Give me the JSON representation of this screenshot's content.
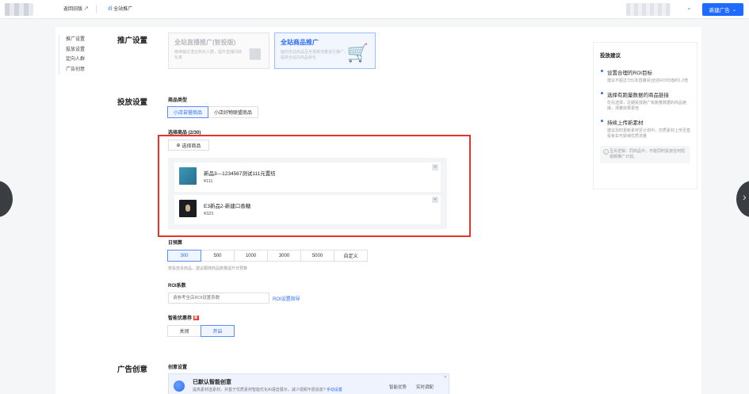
{
  "topbar": {
    "back_label": "返回旧版 ↗",
    "tab_label": "全站推广",
    "new_ad_label": "新建广告",
    "chevron": "⌄"
  },
  "sidenav": {
    "items": [
      "推广设置",
      "投放设置",
      "定向人群",
      "广告创意"
    ]
  },
  "promo": {
    "section_title": "推广设置",
    "cards": [
      {
        "title": "全站直播推广(智投版)",
        "desc": "精准触达潜在购买人群，提升直播间转化率"
      },
      {
        "title": "全站商品推广",
        "desc": "面向全站商品及全场景流量进行推广，提高全站内商品转化"
      }
    ]
  },
  "delivery": {
    "section_title": "投放设置",
    "product_type_label": "商品类型",
    "product_types": [
      "小店自营商品",
      "小店好物联盟商品"
    ],
    "selected_goods_label": "选择商品 (2/30)",
    "select_btn_label": "选择商品",
    "goods": [
      {
        "name": "新品3---1234567测试111元置纺",
        "price": "¥111"
      },
      {
        "name": "E3新品2-新建口香糖",
        "price": "¥323"
      }
    ],
    "budget_label": "日预算",
    "budgets": [
      "300",
      "500",
      "1000",
      "3000",
      "5000",
      "自定义"
    ],
    "budget_hint": "若投放多商品，建议跟随商品数量提升日预算",
    "roi_label": "ROI系数",
    "roi_placeholder": "请参考全店ROI设置系数",
    "roi_link": "ROI设置指导",
    "coupon_label": "智能优惠券",
    "coupon_new_tag": "新",
    "coupon_options": [
      "关闭",
      "开启"
    ]
  },
  "creative": {
    "section_title": "广告创意",
    "setting_label": "创意设置",
    "box_title": "已默认智能创意",
    "box_desc": "提高素材选素材，并基于优质素材智能优化AI语音展示，减少视频不愿投放?",
    "box_link": "手动设置",
    "btn_smart": "智能优势",
    "btn_realtime": "实时调配",
    "close": "✕"
  },
  "suggest": {
    "title": "投放建议",
    "items": [
      {
        "title": "设置合理的ROI目标",
        "desc": "建议不超过7日(本直播间)全店ROI均值的1.2倍"
      },
      {
        "title": "选择有跑量数据的商品链接",
        "desc": "优先选择，近期投放跑广有跑量数据的商品链接，测量效果更佳"
      },
      {
        "title": "持续上传新素材",
        "desc": "建议及时更新素材至计划中，优质素材上传至直投板车可获得优质流量"
      }
    ],
    "note": "互斥逻辑：同商品中，不能同时投放任何短视频推广计划。"
  },
  "icons": {
    "plus": "⊕",
    "close": "✕",
    "chart": "ıll",
    "camera": "◼",
    "cart": "🛒"
  },
  "colors": {
    "accent": "#2f6cf6",
    "highlight": "#e5352b"
  }
}
